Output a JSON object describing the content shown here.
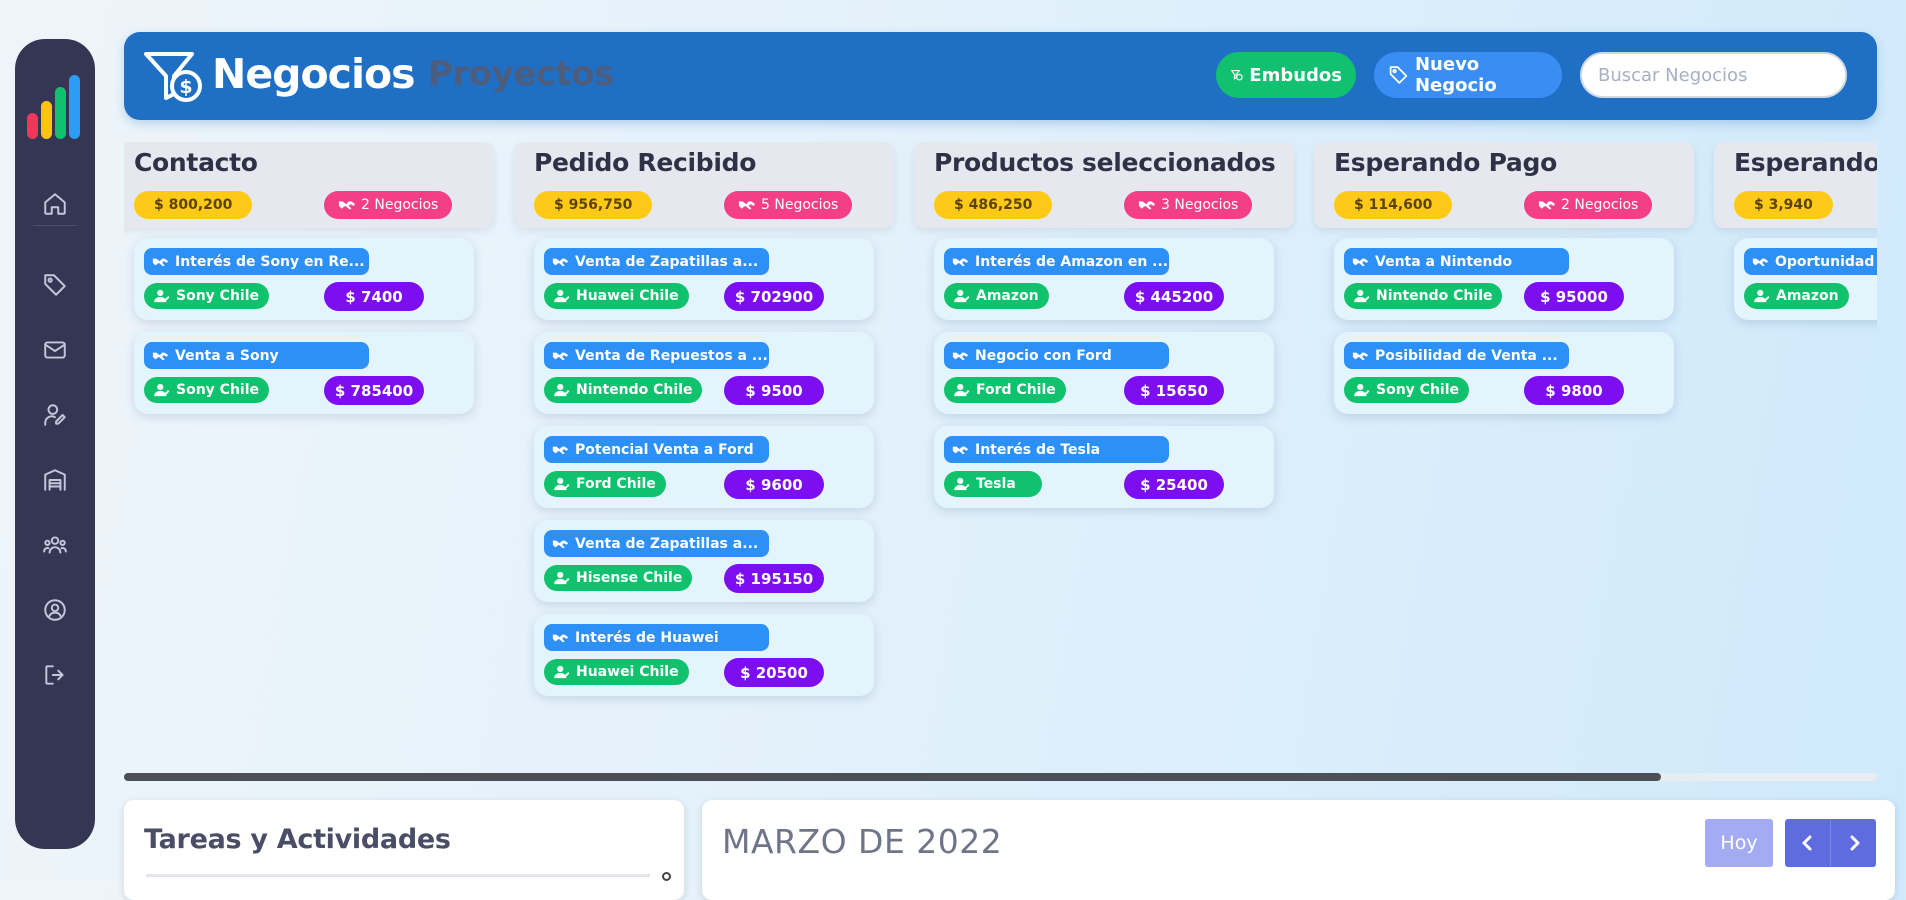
{
  "sidebar": {
    "logo_icon": "bar-chart-logo-icon",
    "items": [
      {
        "icon": "home-icon"
      },
      {
        "icon": "tag-icon"
      },
      {
        "icon": "mail-icon"
      },
      {
        "icon": "user-edit-icon"
      },
      {
        "icon": "warehouse-icon"
      },
      {
        "icon": "users-icon"
      },
      {
        "icon": "user-circle-icon"
      },
      {
        "icon": "logout-icon"
      }
    ]
  },
  "header": {
    "icon": "funnel-dollar-icon",
    "title": "Negocios",
    "subtitle": "Proyectos",
    "funnels_label": "Embudos",
    "new_deal_label": "Nuevo Negocio",
    "search_placeholder": "Buscar Negocios"
  },
  "columns": [
    {
      "title": "Contacto",
      "amount": "$ 800,200",
      "count": "2 Negocios",
      "cards": [
        {
          "title": "Interés de Sony en Re...",
          "company": "Sony Chile",
          "amount": "$ 7400"
        },
        {
          "title": "Venta a Sony",
          "company": "Sony Chile",
          "amount": "$ 785400"
        }
      ]
    },
    {
      "title": "Pedido Recibido",
      "amount": "$ 956,750",
      "count": "5 Negocios",
      "cards": [
        {
          "title": "Venta de Zapatillas a...",
          "company": "Huawei Chile",
          "amount": "$ 702900"
        },
        {
          "title": "Venta de Repuestos a ...",
          "company": "Nintendo Chile",
          "amount": "$ 9500"
        },
        {
          "title": "Potencial Venta a Ford",
          "company": "Ford Chile",
          "amount": "$ 9600"
        },
        {
          "title": "Venta de Zapatillas a...",
          "company": "Hisense Chile",
          "amount": "$ 195150"
        },
        {
          "title": "Interés de Huawei",
          "company": "Huawei Chile",
          "amount": "$ 20500"
        }
      ]
    },
    {
      "title": "Productos seleccionados",
      "amount": "$ 486,250",
      "count": "3 Negocios",
      "cards": [
        {
          "title": "Interés de Amazon en ...",
          "company": "Amazon",
          "amount": "$ 445200"
        },
        {
          "title": "Negocio con Ford",
          "company": "Ford Chile",
          "amount": "$ 15650"
        },
        {
          "title": "Interés de Tesla",
          "company": "Tesla",
          "amount": "$ 25400"
        }
      ]
    },
    {
      "title": "Esperando Pago",
      "amount": "$ 114,600",
      "count": "2 Negocios",
      "cards": [
        {
          "title": "Venta a Nintendo",
          "company": "Nintendo Chile",
          "amount": "$ 95000"
        },
        {
          "title": "Posibilidad de Venta ...",
          "company": "Sony Chile",
          "amount": "$ 9800"
        }
      ]
    },
    {
      "title": "Esperando",
      "amount": "$ 3,940",
      "count": "",
      "cards": [
        {
          "title": "Oportunidad",
          "company": "Amazon",
          "amount": ""
        }
      ]
    }
  ],
  "tasks": {
    "title": "Tareas y Actividades"
  },
  "calendar": {
    "title": "MARZO DE 2022",
    "today_label": "Hoy",
    "prev_icon": "chevron-left-icon",
    "next_icon": "chevron-right-icon"
  },
  "colors": {
    "header_blue": "#1f6fc4",
    "sidebar_dark": "#343653",
    "amount_yellow": "#ffc918",
    "count_pink": "#f23f86",
    "card_title_blue": "#2d90f7",
    "company_green": "#10c26e",
    "deal_amount_purple": "#7d0ef2"
  }
}
